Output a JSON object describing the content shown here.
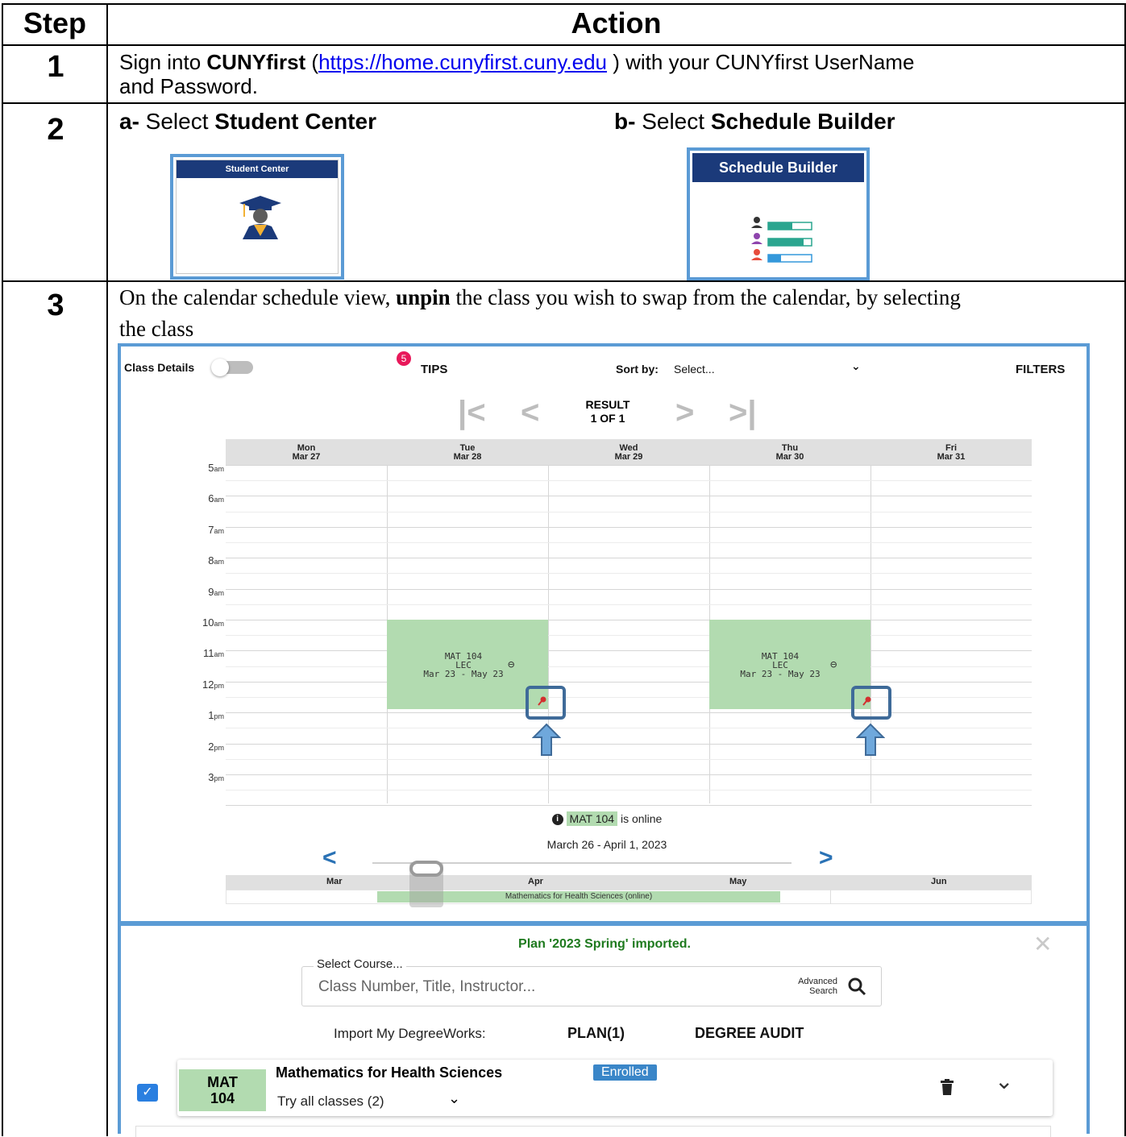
{
  "table": {
    "headers": {
      "step": "Step",
      "action": "Action"
    },
    "step1": {
      "num": "1",
      "prefix": "Sign into ",
      "bold": "CUNYfirst",
      "paren_open": " (",
      "link": "https://home.cunyfirst.cuny.edu",
      "suffix1": " ) with your CUNYfirst UserName",
      "line2": "and Password."
    },
    "step2": {
      "num": "2",
      "a_label": "a-",
      "a_text": " Select ",
      "a_bold": "Student Center",
      "b_label": "b-",
      "b_text": " Select ",
      "b_bold": "Schedule Builder"
    },
    "step3": {
      "num": "3",
      "line1_pre": "On the calendar schedule view, ",
      "line1_bold": "unpin",
      "line1_post": " the class you wish to swap from the calendar, by selecting",
      "line2": "the class"
    }
  },
  "tiles": {
    "student_center": {
      "title": "Student Center",
      "icon": "graduate-icon"
    },
    "schedule_builder": {
      "title": "Schedule Builder",
      "icon": "schedule-list-icon"
    }
  },
  "calendar": {
    "class_details_label": "Class Details",
    "tips_badge": "5",
    "tips_label": "TIPS",
    "sort_label": "Sort by:",
    "sort_value": "Select...",
    "filters_label": "FILTERS",
    "result_line1": "RESULT",
    "result_line2": "1 OF 1",
    "days": [
      {
        "day": "Mon",
        "date": "Mar 27"
      },
      {
        "day": "Tue",
        "date": "Mar 28"
      },
      {
        "day": "Wed",
        "date": "Mar 29"
      },
      {
        "day": "Thu",
        "date": "Mar 30"
      },
      {
        "day": "Fri",
        "date": "Mar 31"
      }
    ],
    "times": [
      {
        "h": "5",
        "p": "am"
      },
      {
        "h": "6",
        "p": "am"
      },
      {
        "h": "7",
        "p": "am"
      },
      {
        "h": "8",
        "p": "am"
      },
      {
        "h": "9",
        "p": "am"
      },
      {
        "h": "10",
        "p": "am"
      },
      {
        "h": "11",
        "p": "am"
      },
      {
        "h": "12",
        "p": "pm"
      },
      {
        "h": "1",
        "p": "pm"
      },
      {
        "h": "2",
        "p": "pm"
      },
      {
        "h": "3",
        "p": "pm"
      }
    ],
    "event": {
      "code": "MAT 104",
      "type": "LEC",
      "range": "Mar 23 - May 23"
    },
    "online_note_code": "MAT 104",
    "online_note_text": " is online",
    "week_range": "March 26 - April 1, 2023",
    "months": [
      "Mar",
      "Apr",
      "May",
      "Jun"
    ],
    "timeline_bar": "Mathematics for Health Sciences (online)"
  },
  "planner": {
    "banner": "Plan '2023 Spring' imported.",
    "select_course_label": "Select Course...",
    "search_placeholder": "Class Number, Title, Instructor...",
    "advanced_line1": "Advanced",
    "advanced_line2": "Search",
    "import_label": "Import My DegreeWorks:",
    "plan_link": "PLAN(1)",
    "audit_link": "DEGREE AUDIT",
    "course": {
      "code_line1": "MAT",
      "code_line2": "104",
      "title": "Mathematics for Health Sciences",
      "status": "Enrolled",
      "try_all": "Try all classes (2)"
    }
  },
  "colors": {
    "tile_border": "#5b9bd5",
    "tile_header": "#1b3a7a",
    "event_green": "#b2dbb0",
    "highlight": "#3f6b99",
    "link_blue": "#0000ee",
    "enrolled_badge": "#3a86c8",
    "banner_green": "#1e7a1e"
  }
}
